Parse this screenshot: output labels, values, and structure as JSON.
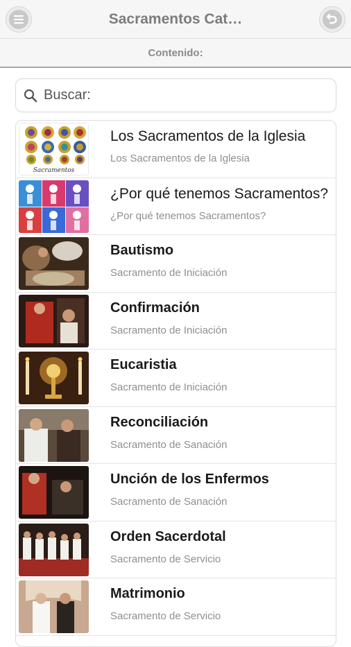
{
  "header": {
    "title": "Sacramentos Cat…",
    "menu_icon": "menu-icon",
    "back_icon": "back-arrow-icon"
  },
  "subheader": {
    "label": "Contenido:"
  },
  "search": {
    "placeholder": "Buscar:",
    "value": "",
    "icon": "search-icon"
  },
  "items": [
    {
      "title": "Los Sacramentos de la Iglesia",
      "subtitle": "Los Sacramentos de la Iglesia",
      "thumb_caption": "Sacramentos"
    },
    {
      "title": "¿Por qué tenemos Sacramentos?",
      "subtitle": "¿Por qué tenemos Sacramentos?"
    },
    {
      "title": "Bautismo",
      "subtitle": "Sacramento de Iniciación"
    },
    {
      "title": "Confirmación",
      "subtitle": "Sacramento de Iniciación"
    },
    {
      "title": "Eucaristia",
      "subtitle": "Sacramento de Iniciación"
    },
    {
      "title": "Reconciliación",
      "subtitle": "Sacramento de Sanación"
    },
    {
      "title": "Unción de los Enfermos",
      "subtitle": "Sacramento de Sanación"
    },
    {
      "title": "Orden Sacerdotal",
      "subtitle": "Sacramento de Servicio"
    },
    {
      "title": "Matrimonio",
      "subtitle": "Sacramento de Servicio"
    }
  ]
}
